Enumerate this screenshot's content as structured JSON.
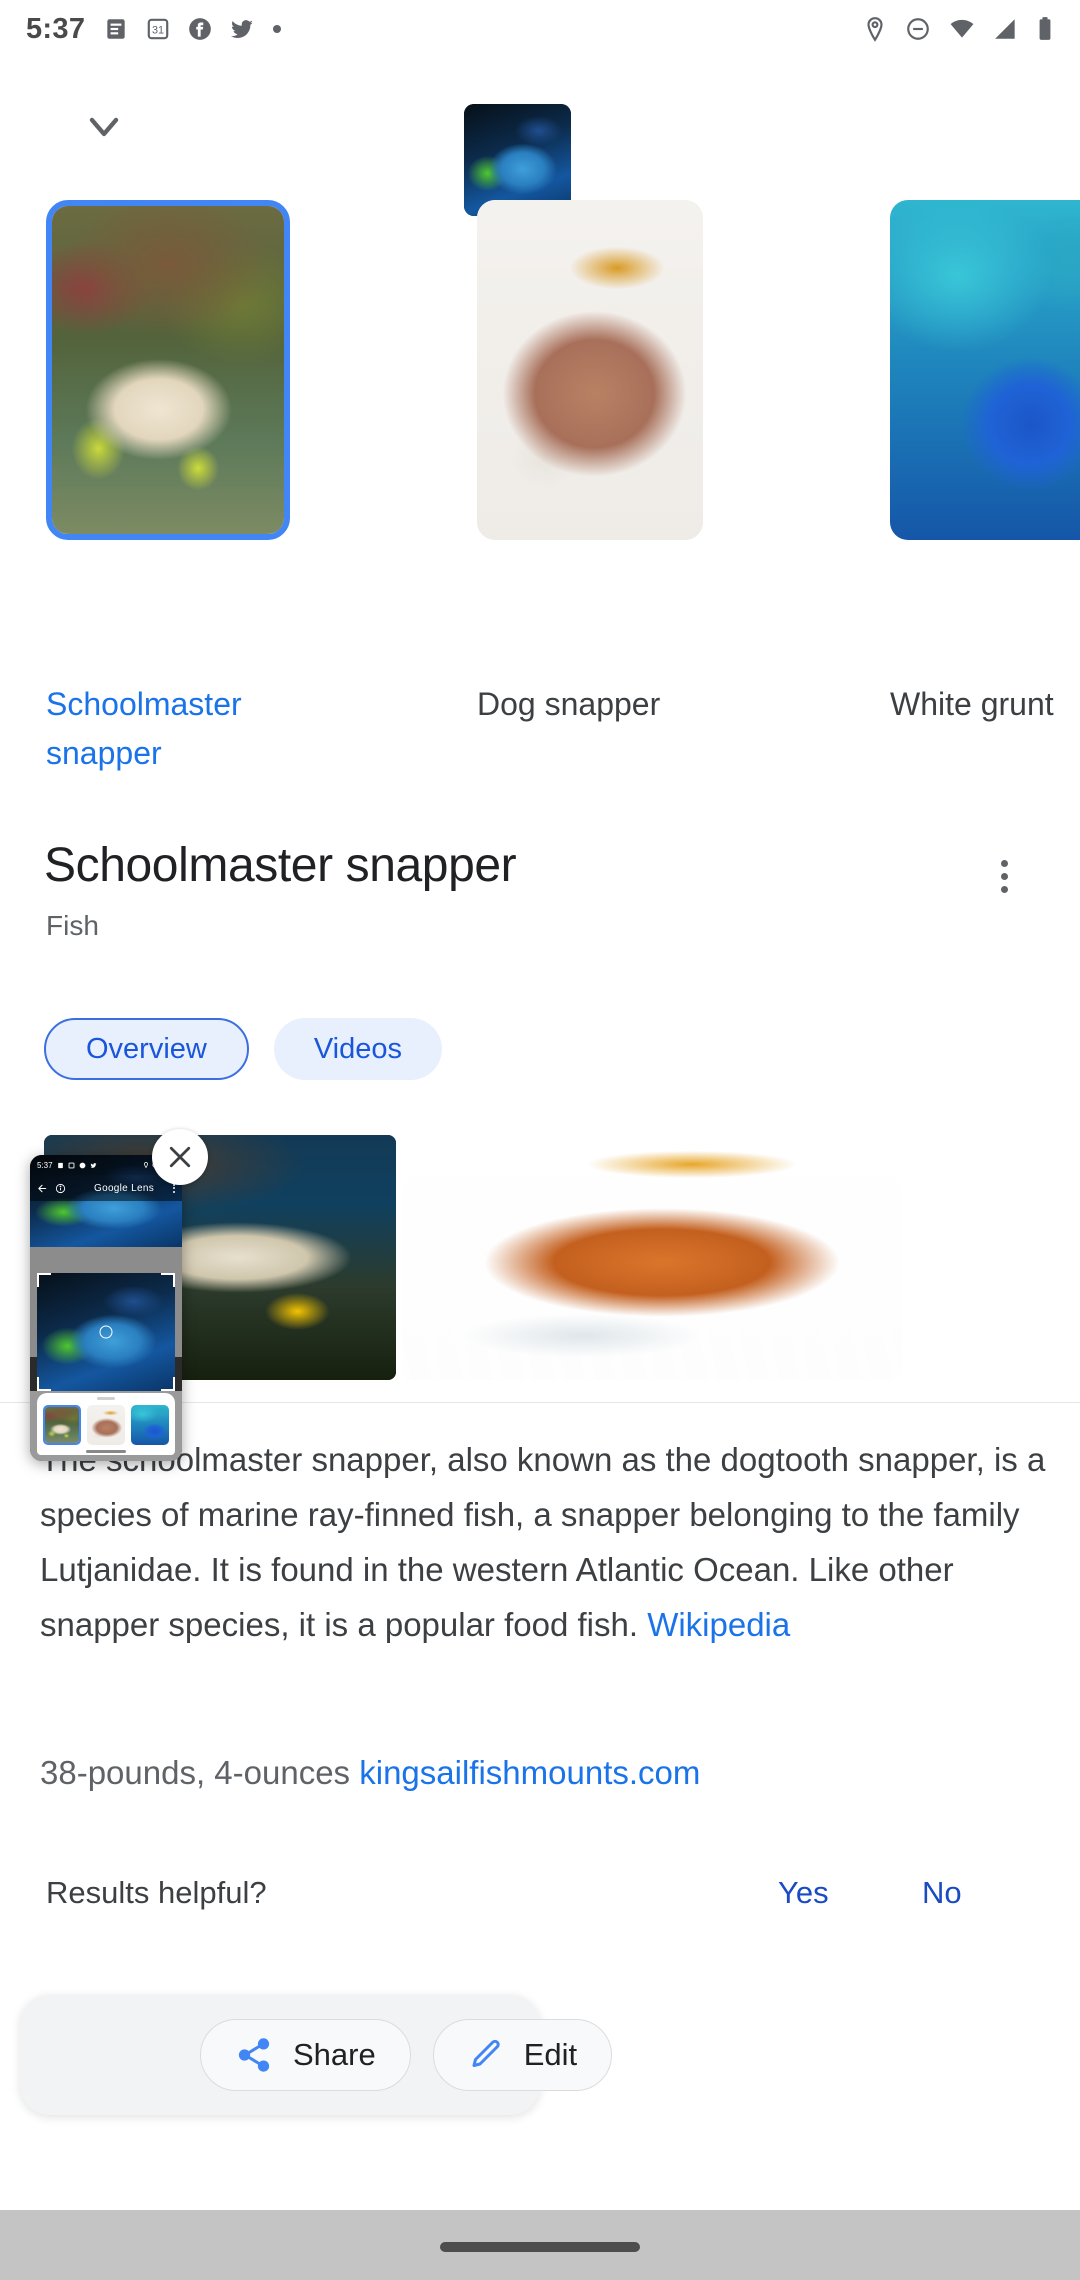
{
  "status_bar": {
    "time": "5:37",
    "left_icons": [
      "message-icon",
      "calendar-31-icon",
      "facebook-icon",
      "twitter-icon",
      "dot-icon"
    ],
    "right_icons": [
      "location-icon",
      "do-not-disturb-icon",
      "wifi-icon",
      "signal-icon",
      "battery-icon"
    ]
  },
  "top_bar": {
    "collapse_icon": "chevron-down-icon",
    "hero_thumb_alt": "night-fish-photo"
  },
  "carousel": {
    "items": [
      {
        "label": "Schoolmaster snapper",
        "selected": true
      },
      {
        "label": "Dog snapper",
        "selected": false
      },
      {
        "label": "White grunt",
        "selected": false
      }
    ]
  },
  "result": {
    "title": "Schoolmaster snapper",
    "subtitle": "Fish",
    "overflow_icon": "more-vert-icon",
    "tabs": [
      {
        "label": "Overview",
        "active": true
      },
      {
        "label": "Videos",
        "active": false
      }
    ],
    "images": [
      "reef-photo",
      "illustration"
    ],
    "description_prefix": "The schoolmaster snapper, also known as the dogtooth snapper, is a species of marine ray-finned fish, a snapper belonging to the family Lutjanidae. It is found in the western Atlantic Ocean. Like other snapper species, it is a popular food fish. ",
    "description_link": "Wikipedia",
    "secondary_text": "38-pounds, 4-ounces ",
    "secondary_link": "kingsailfishmounts.com"
  },
  "feedback": {
    "question": "Results helpful?",
    "yes_label": "Yes",
    "no_label": "No"
  },
  "action_sheet": {
    "share_label": "Share",
    "share_icon": "share-icon",
    "edit_label": "Edit",
    "edit_icon": "pencil-icon"
  },
  "pip": {
    "close_icon": "close-icon",
    "inner": {
      "time": "5:37",
      "app_title": "Google Lens",
      "back_icon": "arrow-back-icon",
      "info_icon": "info-icon",
      "overflow_icon": "more-vert-icon"
    }
  },
  "colors": {
    "accent_blue": "#1a73e8",
    "selection_blue": "#4285f4",
    "chip_bg": "#e8f0fe",
    "text_primary": "#202124",
    "text_secondary": "#5f6368",
    "page_bg": "#ffffff",
    "system_bg": "#c4c4c4"
  }
}
